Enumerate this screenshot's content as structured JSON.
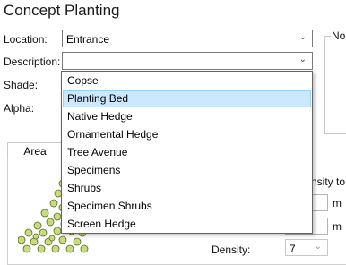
{
  "window": {
    "title": "Concept Planting"
  },
  "form": {
    "location_label": "Location:",
    "location_value": "Entrance",
    "description_label": "Description:",
    "description_value": "",
    "shade_label": "Shade:",
    "alpha_label": "Alpha:",
    "notes_label": "No"
  },
  "tabs": {
    "area": "Area"
  },
  "right_panel": {
    "density_to_label": "nsity to",
    "unit_1": "m",
    "unit_2": "m",
    "density_label": "Density:",
    "density_value": "7"
  },
  "dropdown": {
    "options": [
      "Copse",
      "Planting Bed",
      "Native Hedge",
      "Ornamental Hedge",
      "Tree Avenue",
      "Specimens",
      "Shrubs",
      "Specimen Shrubs",
      "Screen Hedge"
    ],
    "highlighted": "Planting Bed"
  },
  "icons": {
    "chevron": "chevron-down-icon"
  },
  "colors": {
    "highlight": "#cce8ff",
    "plant_fill": "#c8dc78",
    "plant_stroke": "#556b2f"
  }
}
